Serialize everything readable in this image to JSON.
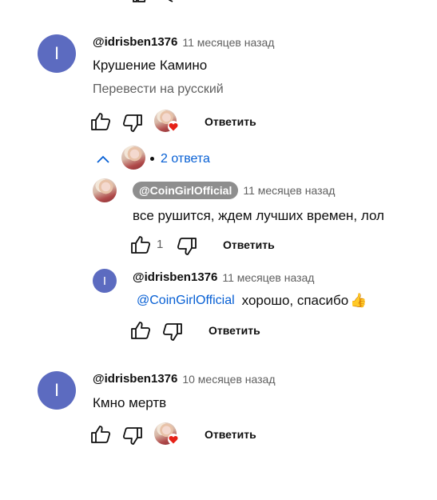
{
  "comments": [
    {
      "handle": "@idrisben1376",
      "time": "11 месяцев назад",
      "avatar_letter": "I",
      "text": "Крушение Камино",
      "translate": "Перевести на русский",
      "reply_label": "Ответить",
      "replies_toggle": "2 ответа"
    },
    {
      "handle": "@idrisben1376",
      "time": "10 месяцев назад",
      "avatar_letter": "I",
      "text": "Кмно мертв",
      "reply_label": "Ответить"
    }
  ],
  "replies": [
    {
      "handle": "@CoinGirlOfficial",
      "time": "11 месяцев назад",
      "text": "все рушится, ждем лучших времен, лол",
      "like_count": "1",
      "reply_label": "Ответить"
    },
    {
      "handle": "@idrisben1376",
      "time": "11 месяцев назад",
      "avatar_letter": "I",
      "mention": "@CoinGirlOfficial",
      "text": "хорошо, спасибо",
      "emoji": "👍",
      "reply_label": "Ответить"
    }
  ],
  "colors": {
    "avatar_bg": "#5c6bc0",
    "link_blue": "#065fd4",
    "chip_bg": "#8e8e8e",
    "heart_red": "#e62117"
  }
}
